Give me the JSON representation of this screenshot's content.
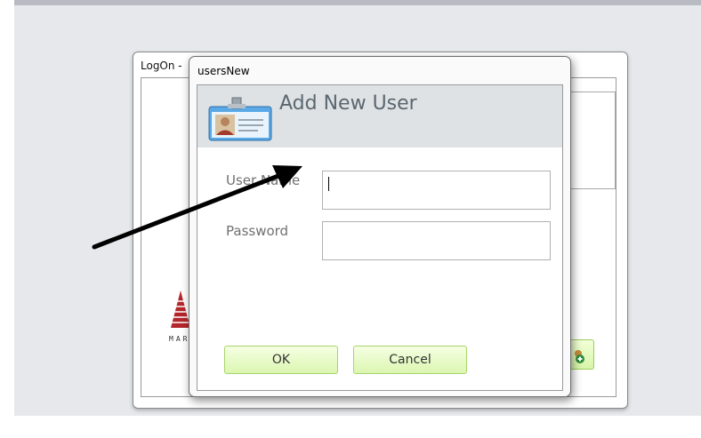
{
  "logon_window": {
    "title": "LogOn -",
    "logo_text": "MAR"
  },
  "dialog": {
    "window_title": "usersNew",
    "header_title": "Add New User",
    "header_icon": "user-card-icon",
    "username_label": "User Name",
    "password_label": "Password",
    "username_value": "",
    "password_value": "",
    "ok_label": "OK",
    "cancel_label": "Cancel"
  },
  "colors": {
    "header_bg": "#dfe2e4",
    "button_bg": "#dcf6b0",
    "button_border": "#a9d46a"
  }
}
